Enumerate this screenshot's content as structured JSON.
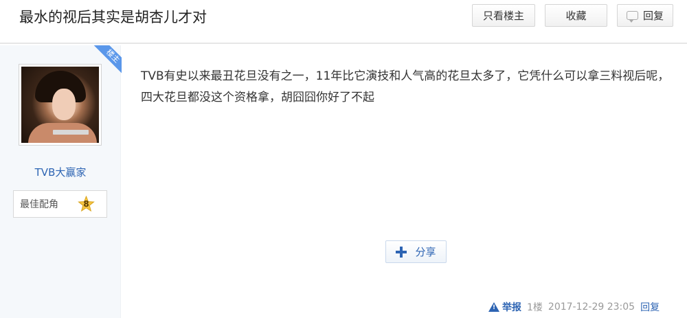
{
  "post": {
    "title": "最水的视后其实是胡杏儿才对",
    "content": "TVB有史以来最丑花旦没有之一，11年比它演技和人气高的花旦太多了，它凭什么可以拿三料视后呢，四大花旦都没这个资格拿，胡囧囧你好了不起"
  },
  "header_buttons": {
    "only_owner": "只看楼主",
    "favorite": "收藏",
    "reply": "回复"
  },
  "user": {
    "name": "TVB大赢家",
    "owner_ribbon": "楼主",
    "badge_label": "最佳配角",
    "badge_level": "8"
  },
  "actions": {
    "share": "分享"
  },
  "footer": {
    "report": "举报",
    "floor": "1楼",
    "time": "2017-12-29 23:05",
    "reply": "回复"
  },
  "colors": {
    "link_blue": "#2d64b3",
    "ribbon_blue": "#5a97ea",
    "badge_gold": "#f6c543"
  }
}
